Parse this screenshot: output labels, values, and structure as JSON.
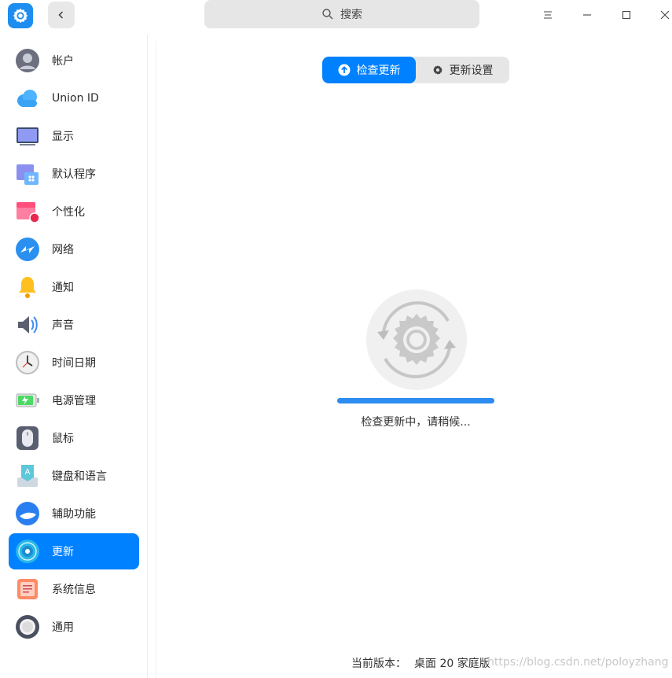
{
  "titlebar": {
    "search_placeholder": "搜索"
  },
  "sidebar": {
    "items": [
      {
        "label": "帐户",
        "icon": "account-icon"
      },
      {
        "label": "Union ID",
        "icon": "cloud-icon"
      },
      {
        "label": "显示",
        "icon": "display-icon"
      },
      {
        "label": "默认程序",
        "icon": "default-apps-icon"
      },
      {
        "label": "个性化",
        "icon": "personalization-icon"
      },
      {
        "label": "网络",
        "icon": "network-icon"
      },
      {
        "label": "通知",
        "icon": "bell-icon"
      },
      {
        "label": "声音",
        "icon": "speaker-icon"
      },
      {
        "label": "时间日期",
        "icon": "clock-icon"
      },
      {
        "label": "电源管理",
        "icon": "battery-icon"
      },
      {
        "label": "鼠标",
        "icon": "mouse-icon"
      },
      {
        "label": "键盘和语言",
        "icon": "keyboard-icon"
      },
      {
        "label": "辅助功能",
        "icon": "accessibility-icon"
      },
      {
        "label": "更新",
        "icon": "update-icon",
        "active": true
      },
      {
        "label": "系统信息",
        "icon": "system-info-icon"
      },
      {
        "label": "通用",
        "icon": "general-icon"
      }
    ]
  },
  "main": {
    "tabs": [
      {
        "label": "检查更新",
        "icon": "upload-circle-icon",
        "active": true
      },
      {
        "label": "更新设置",
        "icon": "gear-icon",
        "active": false
      }
    ],
    "progress_fraction": 1.0,
    "status": "检查更新中，请稍候...",
    "version_label": "当前版本：",
    "version_value": "桌面 20 家庭版",
    "watermark": "https://blog.csdn.net/poloyzhang"
  },
  "colors": {
    "accent": "#0081ff",
    "progress": "#2d8cf0"
  }
}
